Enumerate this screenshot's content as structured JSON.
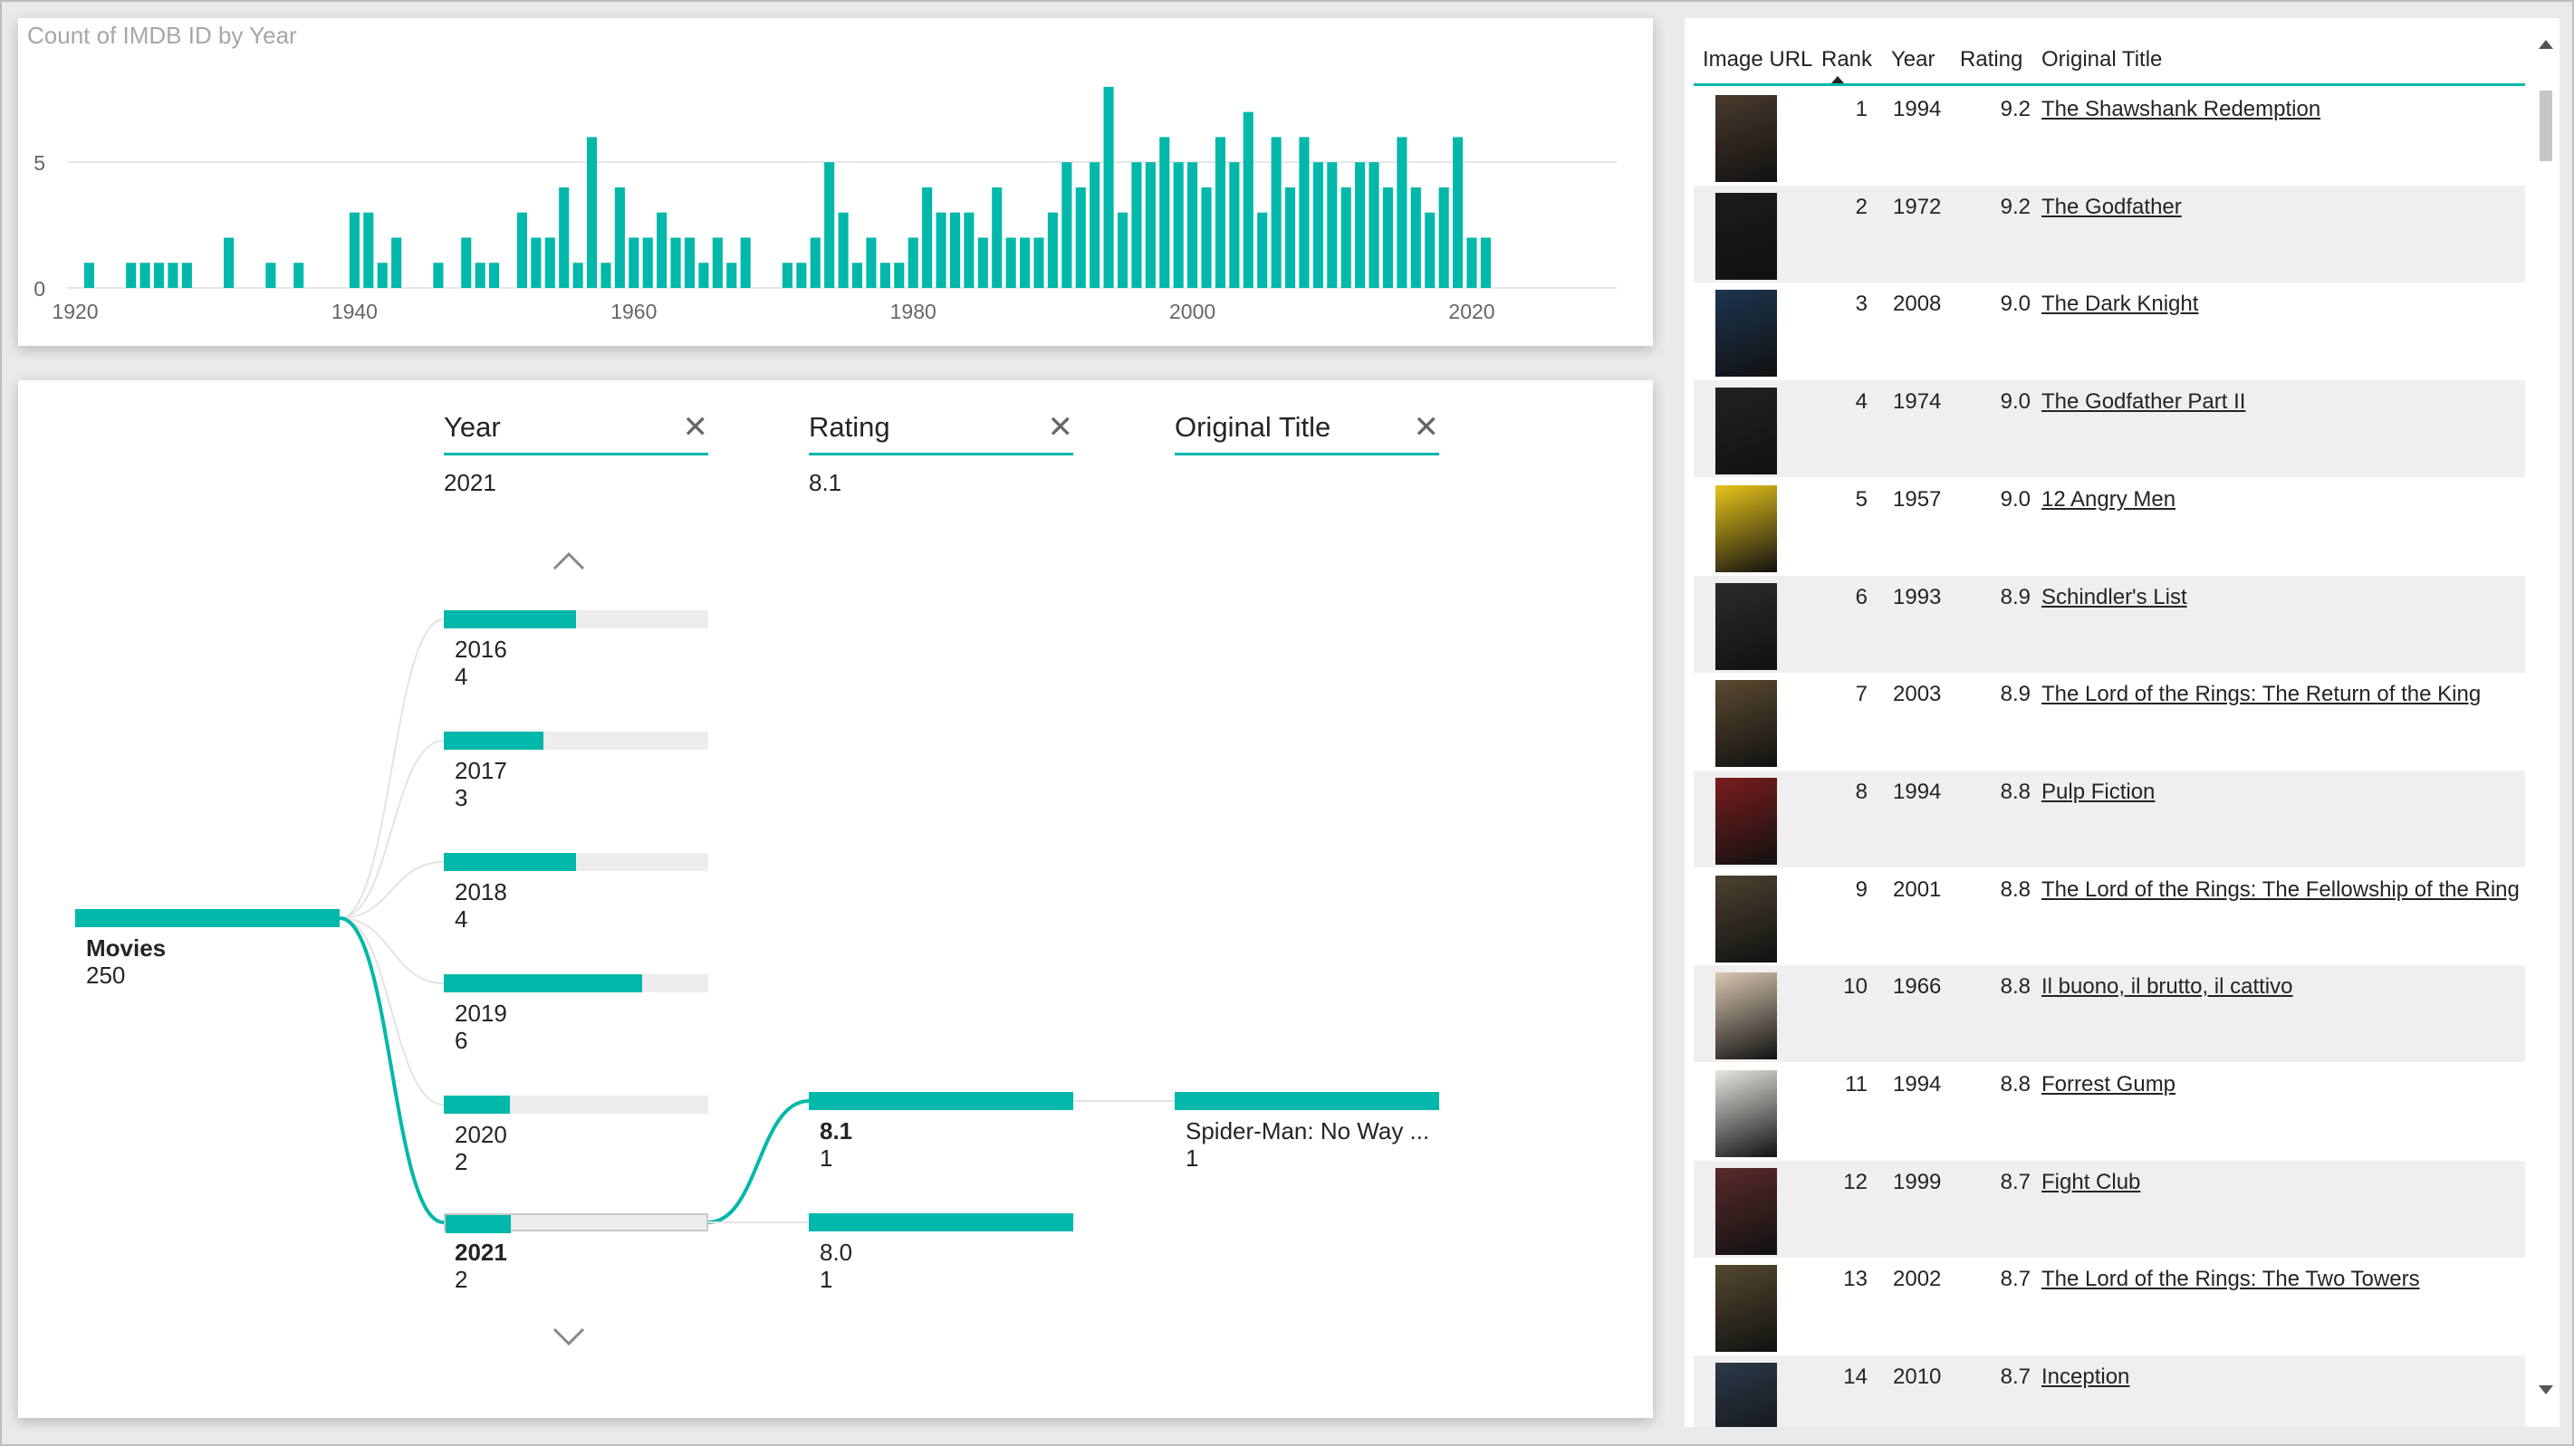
{
  "chart": {
    "title": "Count of IMDB ID by Year",
    "color": "#01B8AA"
  },
  "chart_data": {
    "type": "bar",
    "title": "Count of IMDB ID by Year",
    "xlabel": "",
    "ylabel": "",
    "x_ticks": [
      1920,
      1940,
      1960,
      1980,
      2000,
      2020
    ],
    "y_ticks": [
      0,
      5
    ],
    "ylim": [
      0,
      8.5
    ],
    "xlim": [
      1919,
      2030
    ],
    "grid": true,
    "series": [
      {
        "x": [
          1921,
          1924,
          1925,
          1926,
          1927,
          1928,
          1931,
          1934,
          1936,
          1940,
          1941,
          1942,
          1943,
          1946,
          1948,
          1949,
          1950,
          1952,
          1953,
          1954,
          1955,
          1956,
          1957,
          1958,
          1959,
          1960,
          1961,
          1962,
          1963,
          1964,
          1965,
          1966,
          1967,
          1968,
          1971,
          1972,
          1973,
          1974,
          1975,
          1976,
          1977,
          1978,
          1979,
          1980,
          1981,
          1982,
          1983,
          1984,
          1985,
          1986,
          1987,
          1988,
          1989,
          1990,
          1991,
          1992,
          1993,
          1994,
          1995,
          1996,
          1997,
          1998,
          1999,
          2000,
          2001,
          2002,
          2003,
          2004,
          2005,
          2006,
          2007,
          2008,
          2009,
          2010,
          2011,
          2012,
          2013,
          2014,
          2015,
          2016,
          2017,
          2018,
          2019,
          2020,
          2021
        ],
        "values": [
          1,
          1,
          1,
          1,
          1,
          1,
          2,
          1,
          1,
          3,
          3,
          1,
          2,
          1,
          2,
          1,
          1,
          3,
          2,
          2,
          4,
          1,
          6,
          1,
          4,
          2,
          2,
          3,
          2,
          2,
          1,
          2,
          1,
          2,
          1,
          1,
          2,
          5,
          3,
          1,
          2,
          1,
          1,
          2,
          4,
          3,
          3,
          3,
          2,
          4,
          2,
          2,
          2,
          3,
          5,
          4,
          5,
          8,
          3,
          5,
          5,
          6,
          5,
          5,
          4,
          6,
          5,
          7,
          3,
          6,
          4,
          6,
          5,
          5,
          4,
          5,
          5,
          4,
          6,
          4,
          3,
          4,
          6,
          2,
          2
        ]
      }
    ]
  },
  "tree": {
    "levels": [
      {
        "label": "Year",
        "value": "2021"
      },
      {
        "label": "Rating",
        "value": "8.1"
      },
      {
        "label": "Original Title",
        "value": ""
      }
    ],
    "root": {
      "label": "Movies",
      "count": "250",
      "fraction": 1.0
    },
    "years": [
      {
        "label": "2016",
        "count": "4",
        "fraction": 0.5
      },
      {
        "label": "2017",
        "count": "3",
        "fraction": 0.375
      },
      {
        "label": "2018",
        "count": "4",
        "fraction": 0.5
      },
      {
        "label": "2019",
        "count": "6",
        "fraction": 0.75
      },
      {
        "label": "2020",
        "count": "2",
        "fraction": 0.25
      },
      {
        "label": "2021",
        "count": "2",
        "fraction": 0.25
      }
    ],
    "ratings": [
      {
        "label": "8.1",
        "count": "1",
        "fraction": 1.0
      },
      {
        "label": "8.0",
        "count": "1",
        "fraction": 1.0
      }
    ],
    "titles": [
      {
        "label": "Spider-Man: No Way ...",
        "count": "1",
        "fraction": 1.0
      }
    ],
    "up_icon": "chevron-up-icon",
    "down_icon": "chevron-down-icon",
    "close_icon": "close-icon"
  },
  "table": {
    "columns": [
      "Image URL",
      "Rank",
      "Year",
      "Rating",
      "Original Title"
    ],
    "sort_column": "Rank",
    "rows": [
      {
        "rank": "1",
        "year": "1994",
        "rating": "9.2",
        "title": "The Shawshank Redemption",
        "poster_color": "#4a3a2c"
      },
      {
        "rank": "2",
        "year": "1972",
        "rating": "9.2",
        "title": "The Godfather",
        "poster_color": "#1b1b1b"
      },
      {
        "rank": "3",
        "year": "2008",
        "rating": "9.0",
        "title": "The Dark Knight",
        "poster_color": "#1c3550"
      },
      {
        "rank": "4",
        "year": "1974",
        "rating": "9.0",
        "title": "The Godfather Part II",
        "poster_color": "#222222"
      },
      {
        "rank": "5",
        "year": "1957",
        "rating": "9.0",
        "title": "12 Angry Men",
        "poster_color": "#e8c51a"
      },
      {
        "rank": "6",
        "year": "1993",
        "rating": "8.9",
        "title": "Schindler's List",
        "poster_color": "#2b2b2b"
      },
      {
        "rank": "7",
        "year": "2003",
        "rating": "8.9",
        "title": "The Lord of the Rings: The Return of the King",
        "poster_color": "#5b4a30"
      },
      {
        "rank": "8",
        "year": "1994",
        "rating": "8.8",
        "title": "Pulp Fiction",
        "poster_color": "#7a1d1d"
      },
      {
        "rank": "9",
        "year": "2001",
        "rating": "8.8",
        "title": "The Lord of the Rings: The Fellowship of the Ring",
        "poster_color": "#4c4230"
      },
      {
        "rank": "10",
        "year": "1966",
        "rating": "8.8",
        "title": "Il buono, il brutto, il cattivo",
        "poster_color": "#d9c7b0"
      },
      {
        "rank": "11",
        "year": "1994",
        "rating": "8.8",
        "title": "Forrest Gump",
        "poster_color": "#e9e6e0"
      },
      {
        "rank": "12",
        "year": "1999",
        "rating": "8.7",
        "title": "Fight Club",
        "poster_color": "#5a2a2a"
      },
      {
        "rank": "13",
        "year": "2002",
        "rating": "8.7",
        "title": "The Lord of the Rings: The Two Towers",
        "poster_color": "#54492f"
      },
      {
        "rank": "14",
        "year": "2010",
        "rating": "8.7",
        "title": "Inception",
        "poster_color": "#2b3a4a"
      }
    ]
  },
  "scrollbar": {
    "up_icon": "scroll-up-arrow-icon",
    "down_icon": "scroll-down-arrow-icon"
  }
}
